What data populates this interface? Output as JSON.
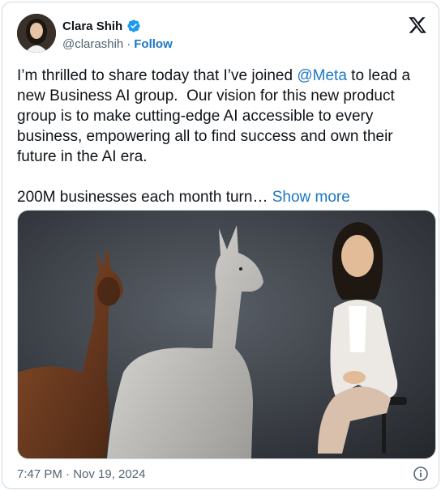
{
  "author": {
    "name": "Clara Shih",
    "handle": "@clarashih",
    "separator": "·",
    "follow_label": "Follow",
    "verified_color": "#1d9bf0"
  },
  "tweet": {
    "text_before_mention": "I’m thrilled to share today that I’ve joined ",
    "mention": "@Meta",
    "text_after_mention": " to lead a new Business AI group.  Our vision for this new product group is to make cutting-edge AI accessible to every business, empowering all to find success and own their future in the AI era.\n\n200M businesses each month turn… ",
    "show_more_label": "Show more",
    "timestamp": "7:47 PM · Nov 19, 2024"
  },
  "icons": {
    "logo": "x-logo-icon",
    "verified": "verified-badge-icon",
    "info": "info-icon"
  },
  "colors": {
    "link": "#1d77c2",
    "text": "#0f1419",
    "muted": "#536471",
    "border": "#cfd9de"
  }
}
